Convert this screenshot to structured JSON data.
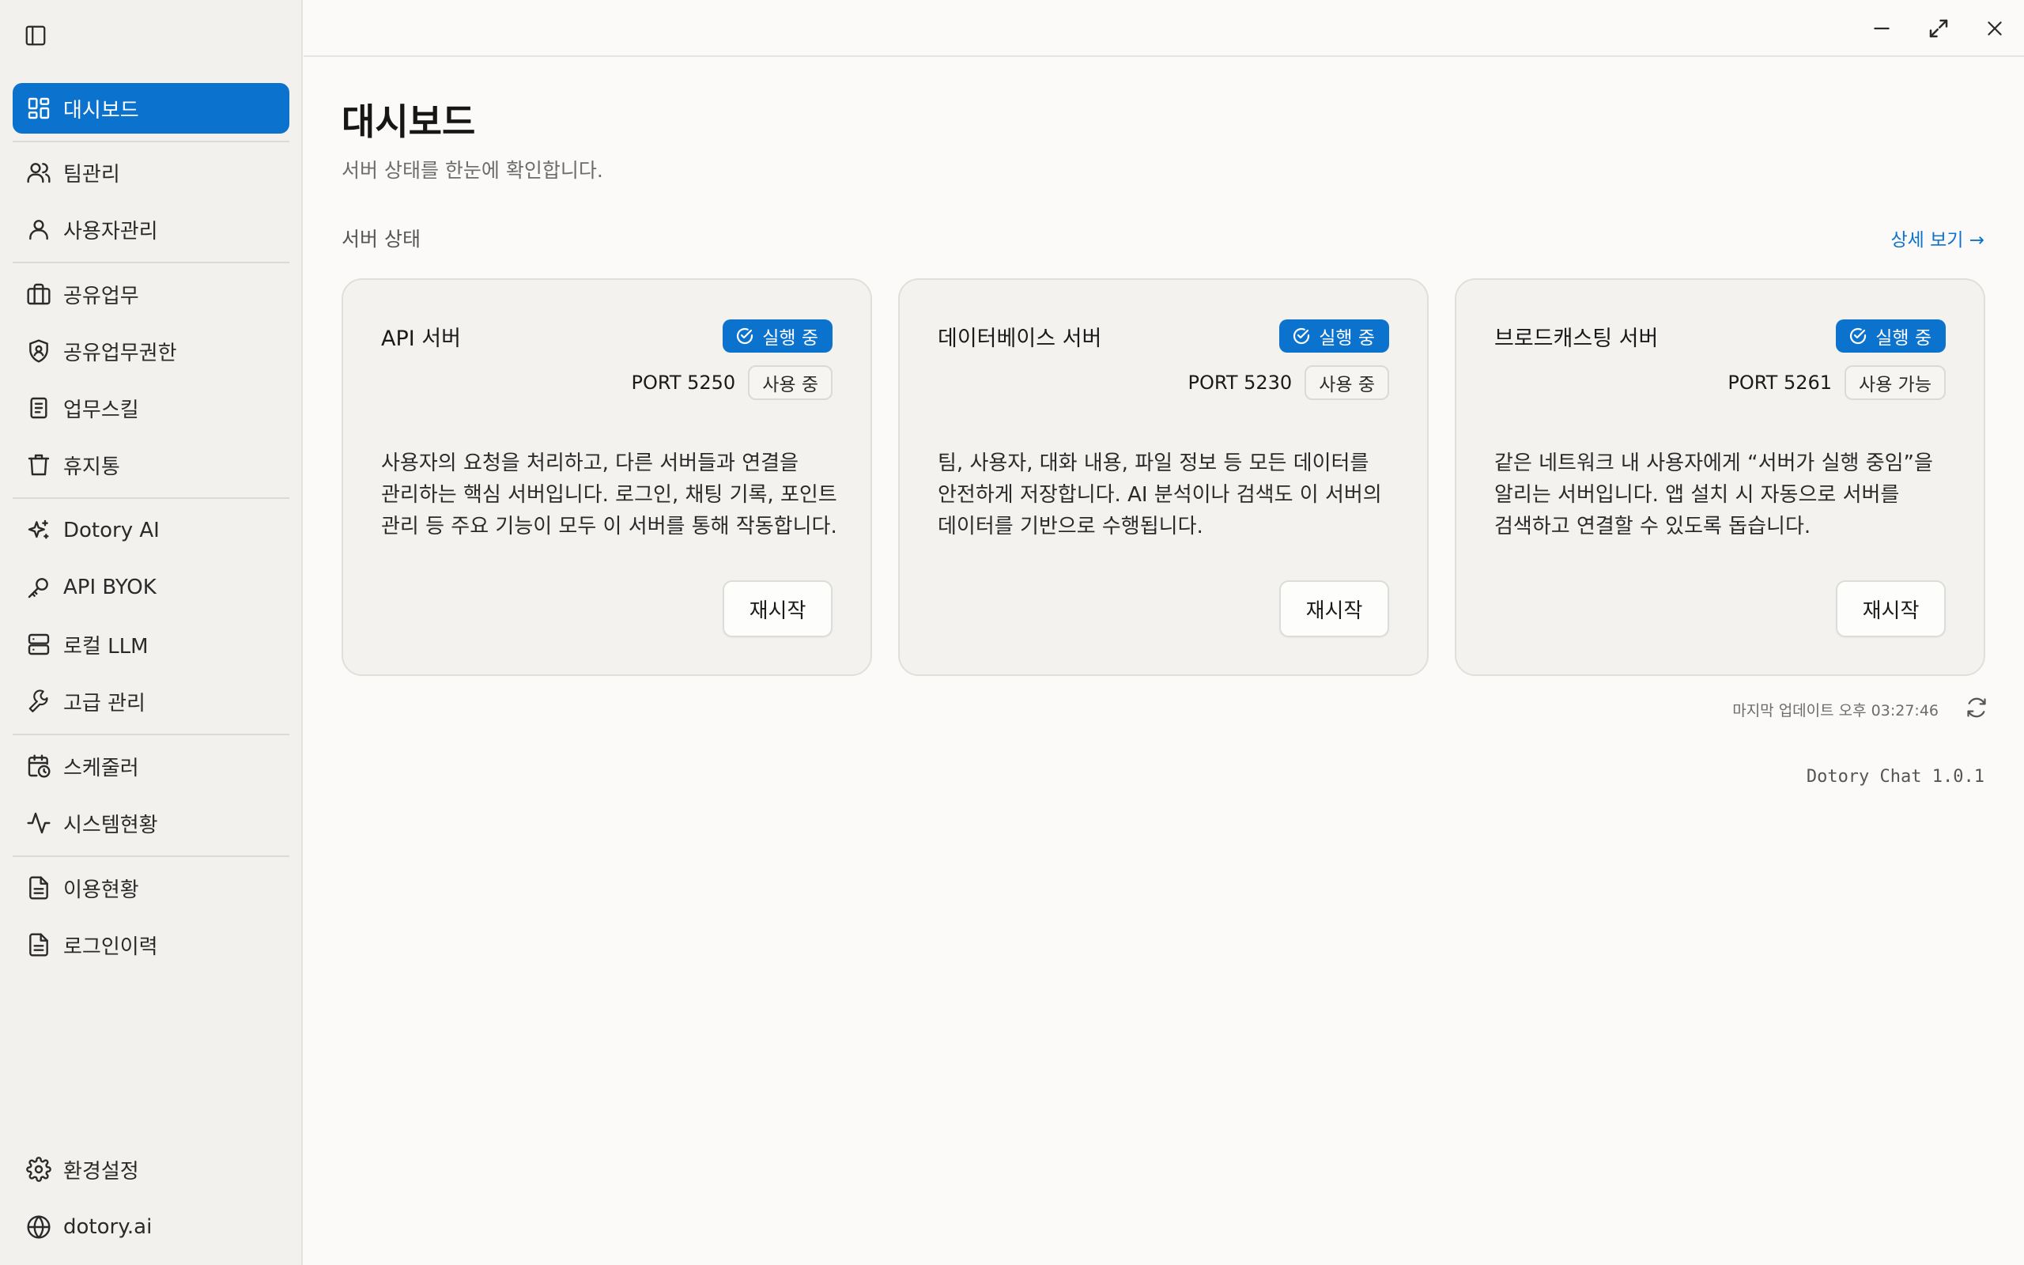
{
  "sidebar": {
    "items": [
      {
        "label": "대시보드",
        "icon": "dashboard-icon",
        "active": true
      },
      {
        "label": "팀관리",
        "icon": "users-icon"
      },
      {
        "label": "사용자관리",
        "icon": "user-icon"
      },
      {
        "label": "공유업무",
        "icon": "briefcase-icon"
      },
      {
        "label": "공유업무권한",
        "icon": "shield-icon"
      },
      {
        "label": "업무스킬",
        "icon": "document-icon"
      },
      {
        "label": "휴지통",
        "icon": "trash-icon"
      },
      {
        "label": "Dotory AI",
        "icon": "sparkles-icon"
      },
      {
        "label": "API BYOK",
        "icon": "key-icon"
      },
      {
        "label": "로컬 LLM",
        "icon": "server-icon"
      },
      {
        "label": "고급 관리",
        "icon": "wrench-icon"
      },
      {
        "label": "스케줄러",
        "icon": "calendar-clock-icon"
      },
      {
        "label": "시스템현황",
        "icon": "activity-icon"
      },
      {
        "label": "이용현황",
        "icon": "file-text-icon"
      },
      {
        "label": "로그인이력",
        "icon": "file-text-icon"
      }
    ],
    "footer": [
      {
        "label": "환경설정",
        "icon": "gear-icon"
      },
      {
        "label": "dotory.ai",
        "icon": "globe-icon"
      }
    ]
  },
  "main": {
    "title": "대시보드",
    "subtitle": "서버 상태를 한눈에 확인합니다.",
    "section_title": "서버 상태",
    "details_link": "상세 보기 →",
    "servers": [
      {
        "name": "API 서버",
        "status": "실행 중",
        "port": "PORT 5250",
        "port_status": "사용 중",
        "description": "사용자의 요청을 처리하고, 다른 서버들과 연결을 관리하는 핵심 서버입니다. 로그인, 채팅 기록, 포인트 관리 등 주요 기능이 모두 이 서버를 통해 작동합니다.",
        "restart": "재시작"
      },
      {
        "name": "데이터베이스 서버",
        "status": "실행 중",
        "port": "PORT 5230",
        "port_status": "사용 중",
        "description": "팀, 사용자, 대화 내용, 파일 정보 등 모든 데이터를 안전하게 저장합니다. AI 분석이나 검색도 이 서버의 데이터를 기반으로 수행됩니다.",
        "restart": "재시작"
      },
      {
        "name": "브로드캐스팅 서버",
        "status": "실행 중",
        "port": "PORT 5261",
        "port_status": "사용 가능",
        "description": "같은 네트워크 내 사용자에게 “서버가 실행 중임”을 알리는 서버입니다. 앱 설치 시 자동으로 서버를 검색하고 연결할 수 있도록 돕습니다.",
        "restart": "재시작"
      }
    ],
    "last_update": "마지막 업데이트 오후 03:27:46",
    "version": "Dotory Chat 1.0.1"
  },
  "colors": {
    "accent": "#0b73cd",
    "sidebar_bg": "#f2f1ee",
    "page_bg": "#fbfaf8",
    "card_bg": "#f3f2ef"
  }
}
